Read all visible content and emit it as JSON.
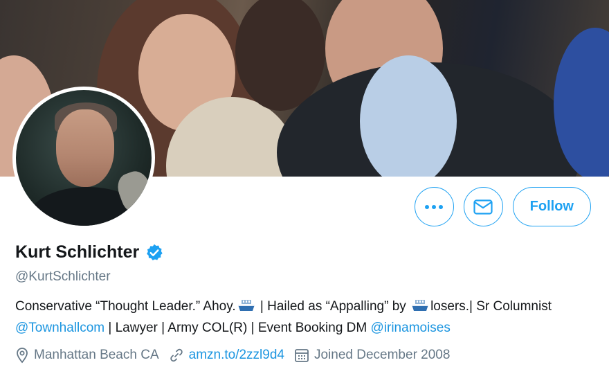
{
  "profile": {
    "name": "Kurt Schlichter",
    "handle": "@KurtSchlichter",
    "verified": true
  },
  "actions": {
    "more_icon": "more-dots-icon",
    "message_icon": "envelope-icon",
    "follow_label": "Follow"
  },
  "bio": {
    "part1": "Conservative “Thought Leader.” Ahoy.",
    "part2": " | Hailed as “Appalling” by ",
    "part3": "losers.| Sr Columnist ",
    "mention1": "@Townhallcom",
    "part4": " | Lawyer | Army COL(R) | Event Booking DM ",
    "mention2": "@irinamoises"
  },
  "meta": {
    "location": "Manhattan Beach CA",
    "url": "amzn.to/2zzl9d4",
    "joined": "Joined December 2008"
  },
  "colors": {
    "accent": "#1da1f2",
    "link": "#1b95e0",
    "secondary_text": "#657786"
  }
}
